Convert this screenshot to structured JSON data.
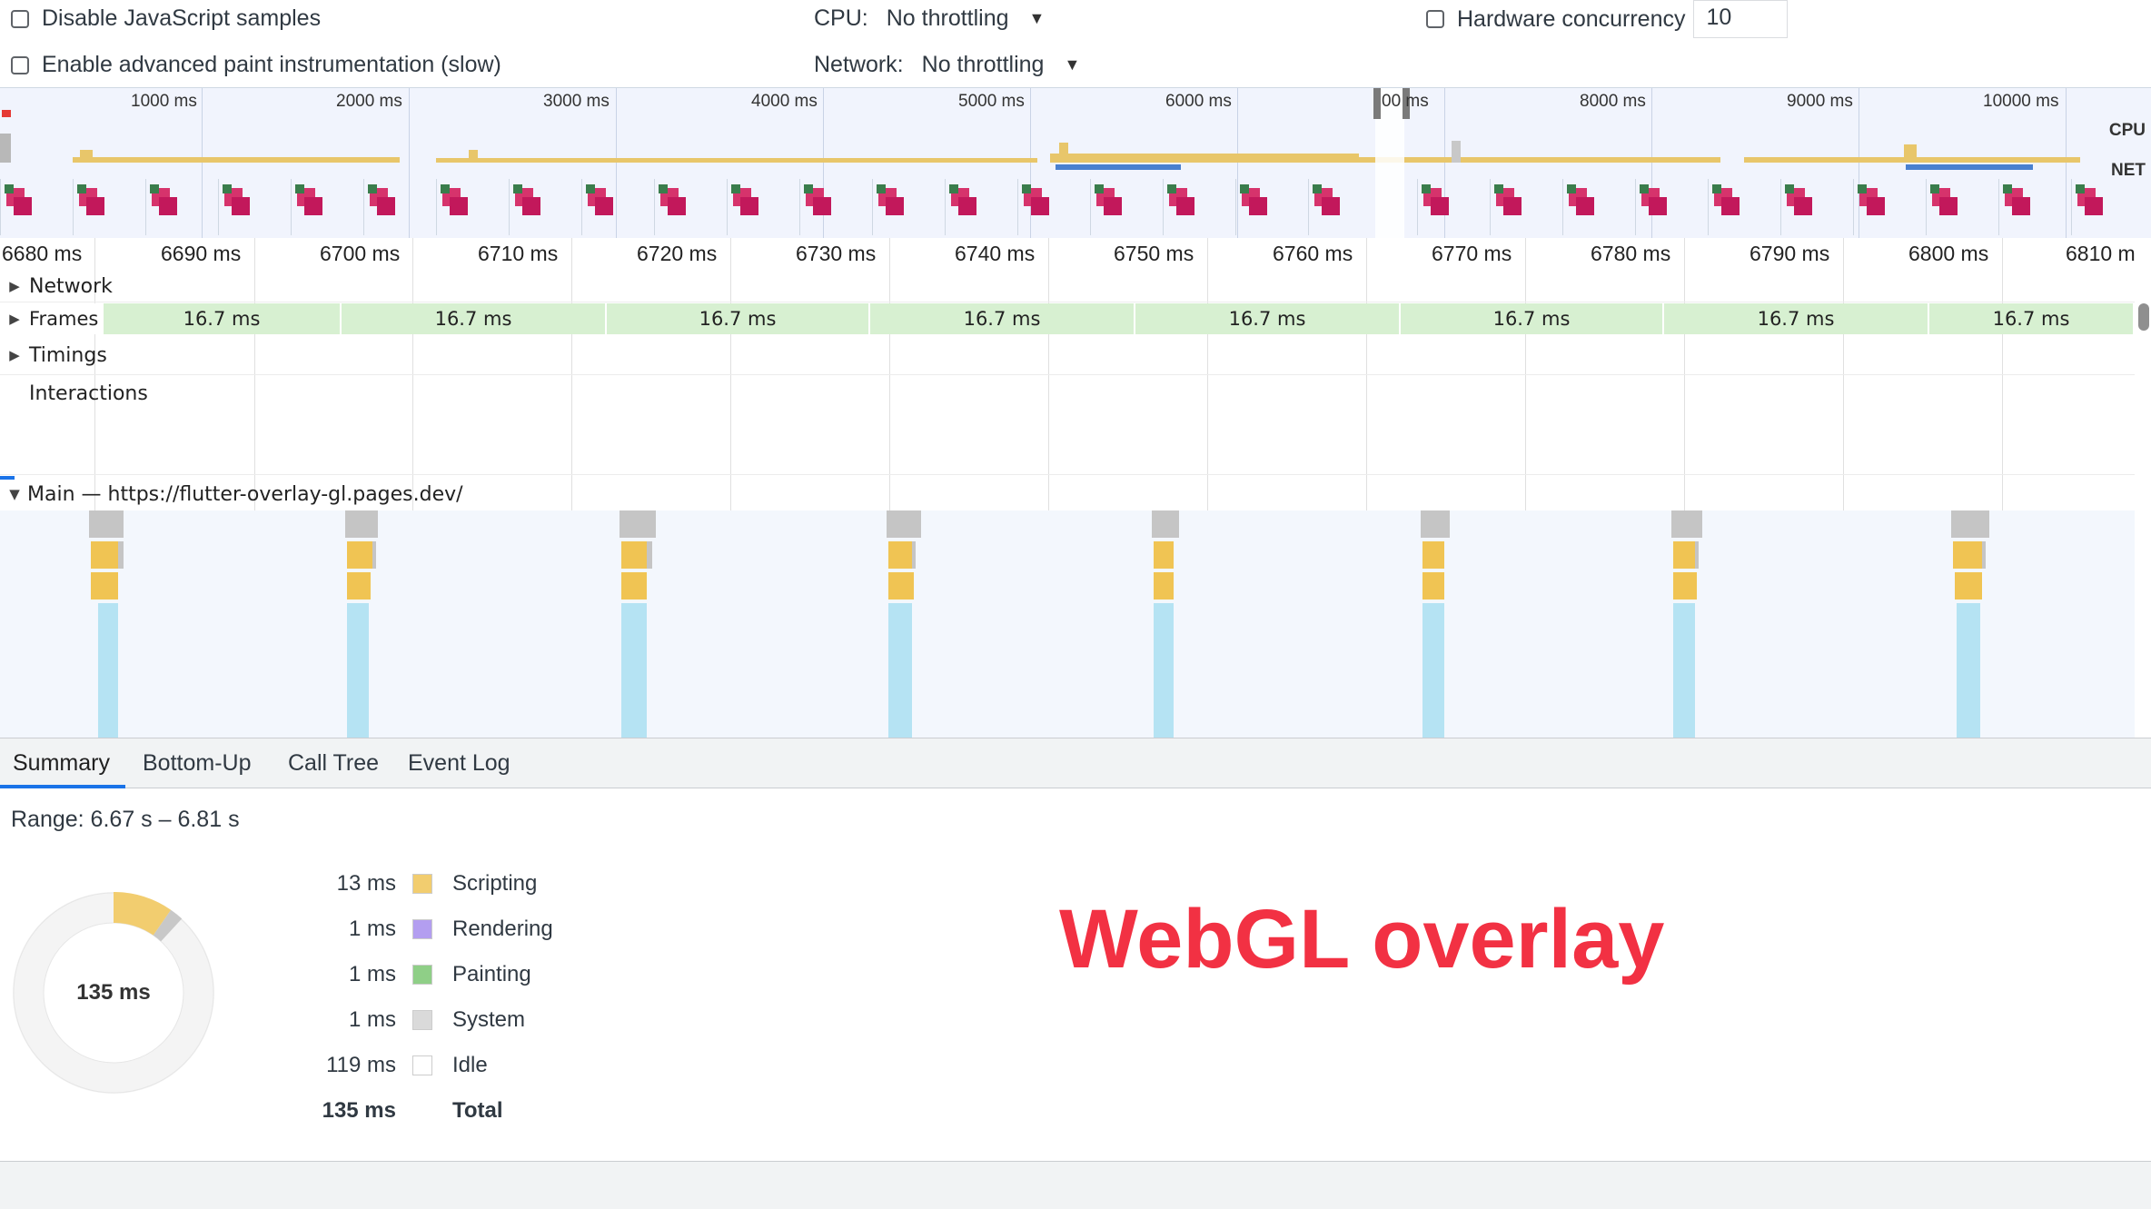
{
  "settings": {
    "disable_js_samples": "Disable JavaScript samples",
    "advanced_paint": "Enable advanced paint instrumentation (slow)",
    "cpu_label": "CPU:",
    "cpu_value": "No throttling",
    "network_label": "Network:",
    "network_value": "No throttling",
    "hardware_concurrency_label": "Hardware concurrency",
    "hardware_concurrency_value": "10"
  },
  "overview": {
    "ticks": [
      "1000 ms",
      "2000 ms",
      "3000 ms",
      "4000 ms",
      "5000 ms",
      "6000 ms",
      "00 ms",
      "8000 ms",
      "9000 ms",
      "10000 ms"
    ],
    "cpu_label": "CPU",
    "net_label": "NET"
  },
  "ruler": {
    "labels": [
      "6680 ms",
      "6690 ms",
      "6700 ms",
      "6710 ms",
      "6720 ms",
      "6730 ms",
      "6740 ms",
      "6750 ms",
      "6760 ms",
      "6770 ms",
      "6780 ms",
      "6790 ms",
      "6800 ms",
      "6810 m"
    ]
  },
  "tracks": {
    "network": "Network",
    "frames": "Frames",
    "timings": "Timings",
    "interactions": "Interactions",
    "main": "Main — https://flutter-overlay-gl.pages.dev/"
  },
  "frames": [
    "16.7 ms",
    "16.7 ms",
    "16.7 ms",
    "16.7 ms",
    "16.7 ms",
    "16.7 ms",
    "16.7 ms",
    "16.7 ms"
  ],
  "tabs": [
    "Summary",
    "Bottom-Up",
    "Call Tree",
    "Event Log"
  ],
  "summary": {
    "range": "Range: 6.67 s – 6.81 s",
    "pie_total": "135 ms",
    "rows": [
      {
        "value": "13 ms",
        "label": "Scripting",
        "color": "#f2cd6f"
      },
      {
        "value": "1 ms",
        "label": "Rendering",
        "color": "#b39ef0"
      },
      {
        "value": "1 ms",
        "label": "Painting",
        "color": "#8fcf87"
      },
      {
        "value": "1 ms",
        "label": "System",
        "color": "#dadada"
      },
      {
        "value": "119 ms",
        "label": "Idle",
        "color": "#ffffff"
      }
    ],
    "total_value": "135 ms",
    "total_label": "Total"
  },
  "overlay_text": "WebGL overlay"
}
